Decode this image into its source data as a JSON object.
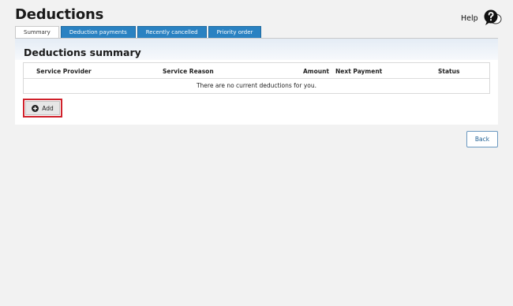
{
  "page": {
    "title": "Deductions"
  },
  "help": {
    "label": "Help",
    "icon": "help-speech-bubble-icon"
  },
  "tabs": [
    {
      "label": "Summary",
      "active": true
    },
    {
      "label": "Deduction payments",
      "active": false
    },
    {
      "label": "Recently cancelled",
      "active": false
    },
    {
      "label": "Priority order",
      "active": false
    }
  ],
  "summary": {
    "title": "Deductions summary",
    "columns": {
      "service_provider": "Service Provider",
      "service_reason": "Service Reason",
      "amount": "Amount",
      "next_payment": "Next Payment",
      "status": "Status"
    },
    "empty_message": "There are no current deductions for you."
  },
  "actions": {
    "add_label": "Add",
    "add_icon": "plus-circle-icon",
    "back_label": "Back"
  },
  "colors": {
    "tab_active_bg": "#ffffff",
    "tab_bg": "#2a82c2",
    "highlight": "#d0212b",
    "back_border": "#6a98c0"
  }
}
